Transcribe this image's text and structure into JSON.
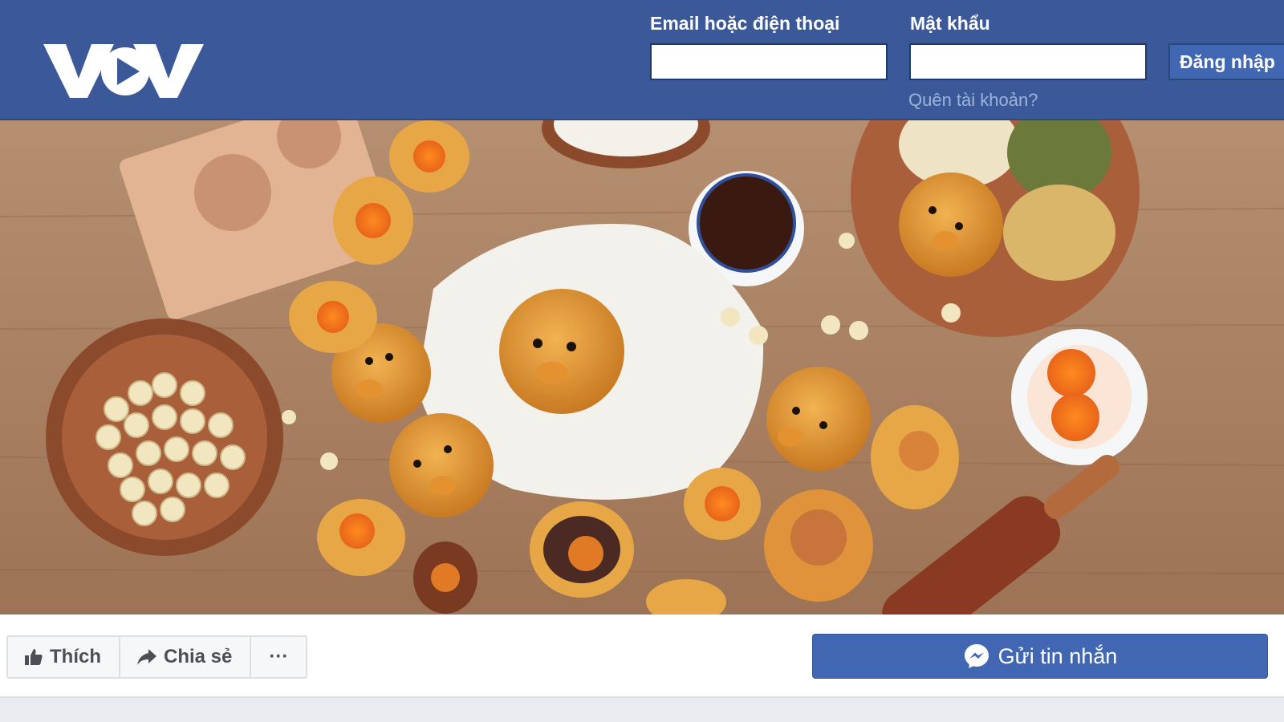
{
  "header": {
    "logo_text": "VOV",
    "email_label": "Email hoặc điện thoại",
    "email_value": "",
    "password_label": "Mật khẩu",
    "password_value": "",
    "login_button": "Đăng nhập",
    "forgot_link": "Quên tài khoản?",
    "colors": {
      "bar": "#3b5998",
      "button": "#4267b2"
    }
  },
  "cover": {
    "icon": "mooncake-cover-photo"
  },
  "actions": {
    "like_label": "Thích",
    "share_label": "Chia sẻ",
    "more_label": "···",
    "message_label": "Gửi tin nhắn",
    "icons": [
      "thumbs-up-icon",
      "share-arrow-icon",
      "more-dots-icon",
      "messenger-icon"
    ]
  }
}
